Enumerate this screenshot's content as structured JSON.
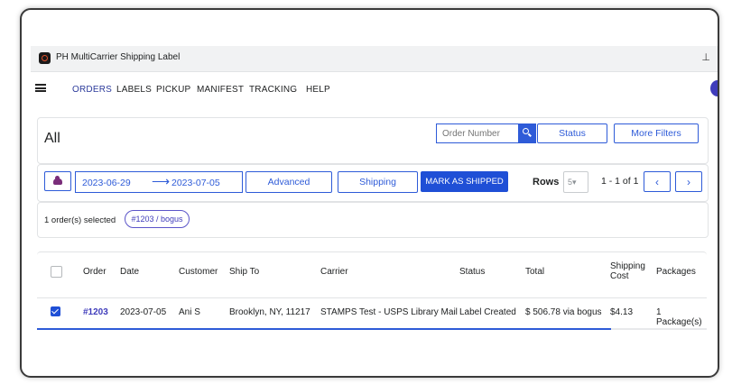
{
  "window": {
    "title": "PH MultiCarrier Shipping Label",
    "pin_icon": "pin-icon"
  },
  "nav": {
    "items": [
      "ORDERS",
      "LABELS",
      "PICKUP",
      "MANIFEST",
      "TRACKING",
      "HELP"
    ],
    "active": "ORDERS"
  },
  "header": {
    "title": "All",
    "search_placeholder": "Order Number",
    "status_label": "Status",
    "more_filters_label": "More Filters"
  },
  "toolbar": {
    "date_start": "2023-06-29",
    "date_arrow": "⟶",
    "date_end": "2023-07-05",
    "advanced_label": "Advanced",
    "shipping_label": "Shipping",
    "mark_shipped_label": "MARK AS SHIPPED",
    "rows_label": "Rows",
    "rows_value": "5",
    "pager_text": "1 - 1 of 1",
    "prev": "‹",
    "next": "›"
  },
  "selection": {
    "text": "1 order(s) selected",
    "chip": "#1203 / bogus"
  },
  "table": {
    "columns": [
      "Order",
      "Date",
      "Customer",
      "Ship To",
      "Carrier",
      "Status",
      "Total",
      "Shipping Cost",
      "Packages"
    ],
    "rows": [
      {
        "order": "#1203",
        "date": "2023-07-05",
        "customer": "Ani S",
        "ship_to": "Brooklyn, NY, 11217",
        "carrier": "STAMPS Test - USPS Library Mail",
        "status": "Label Created",
        "total": "$ 506.78 via bogus",
        "shipping_cost": "$4.13",
        "packages": "1 Package(s)",
        "checked": true
      }
    ]
  },
  "colors": {
    "accent": "#2e5bd8",
    "primary_button": "#1f4fd6",
    "active_nav": "#2c3b9b"
  }
}
